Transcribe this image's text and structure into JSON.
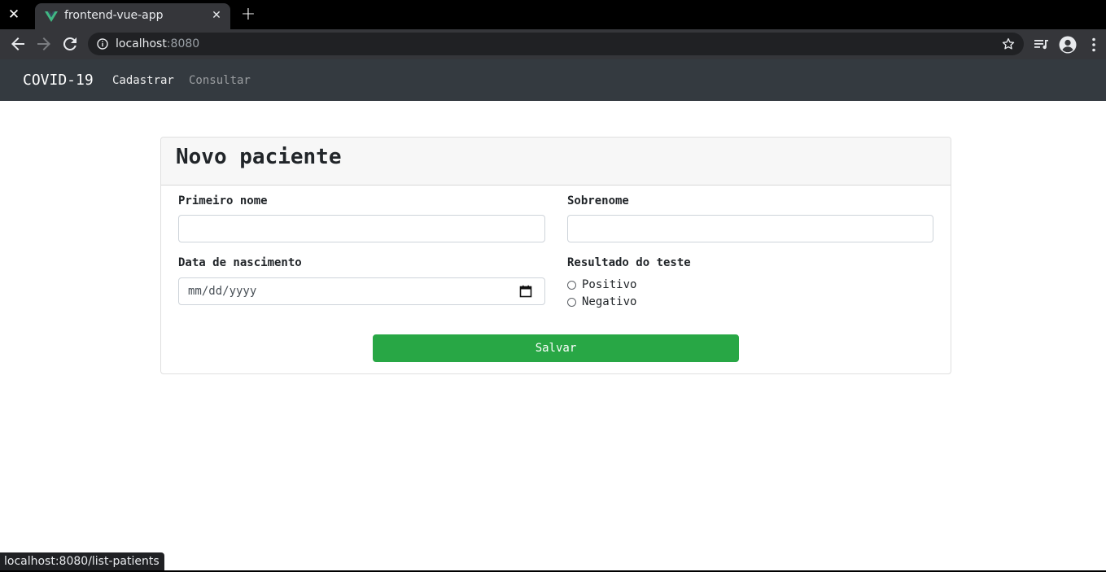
{
  "browser": {
    "tab_title": "frontend-vue-app",
    "url_host": "localhost",
    "url_port": ":8080",
    "status_url": "localhost:8080/list-patients"
  },
  "navbar": {
    "brand": "COVID-19",
    "links": [
      {
        "label": "Cadastrar",
        "active": true
      },
      {
        "label": "Consultar",
        "active": false
      }
    ]
  },
  "form": {
    "title": "Novo paciente",
    "first_name": {
      "label": "Primeiro nome",
      "value": ""
    },
    "last_name": {
      "label": "Sobrenome",
      "value": ""
    },
    "birth_date": {
      "label": "Data de nascimento",
      "placeholder": "mm/dd/yyyy"
    },
    "test_result": {
      "label": "Resultado do teste",
      "options": [
        {
          "label": "Positivo",
          "checked": false
        },
        {
          "label": "Negativo",
          "checked": false
        }
      ]
    },
    "submit_label": "Salvar"
  },
  "colors": {
    "navbar": "#343a40",
    "primary_button": "#28a745",
    "vue_green": "#41b883",
    "vue_dark": "#34495e"
  }
}
